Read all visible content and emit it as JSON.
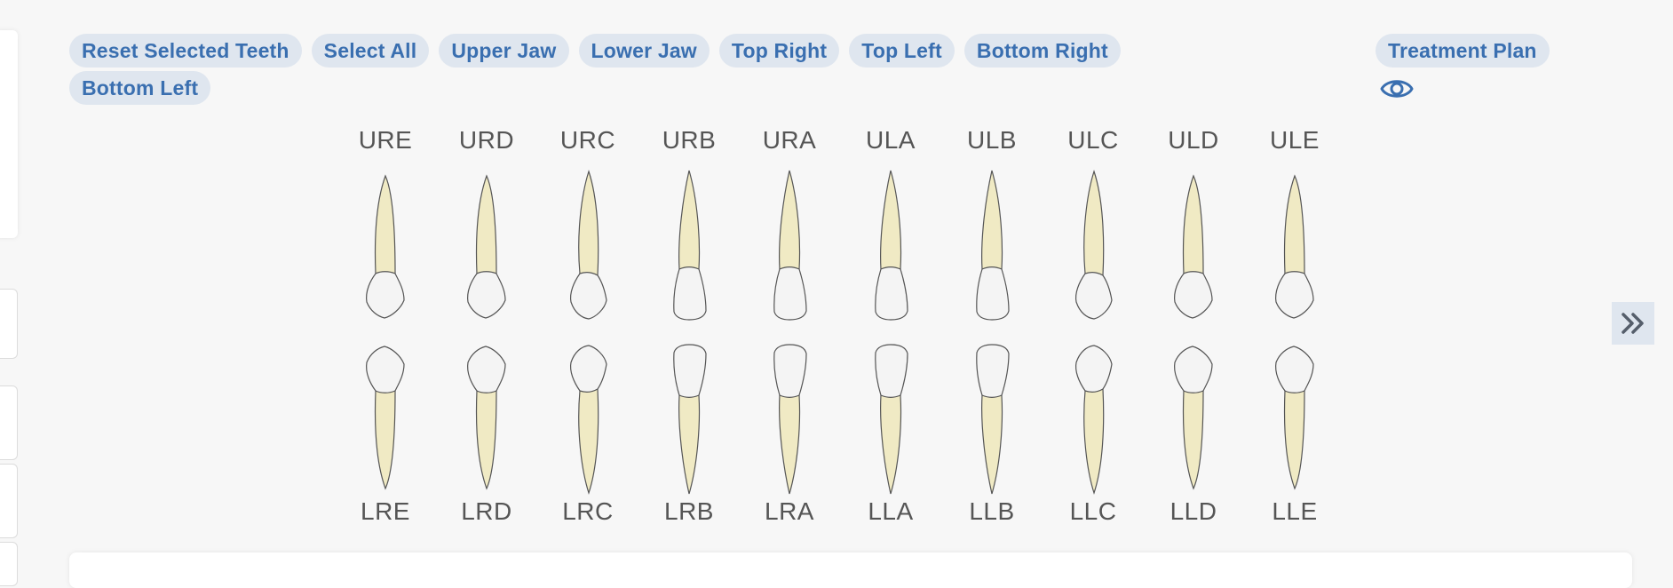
{
  "toolbar": {
    "reset_label": "Reset Selected Teeth",
    "select_all_label": "Select All",
    "upper_jaw_label": "Upper Jaw",
    "lower_jaw_label": "Lower Jaw",
    "top_right_label": "Top Right",
    "top_left_label": "Top Left",
    "bottom_right_label": "Bottom Right",
    "bottom_left_label": "Bottom Left"
  },
  "treatment_plan": {
    "label": "Treatment Plan",
    "icon": "eye-icon"
  },
  "expand_panel": {
    "icon": "double-chevron-right-icon"
  },
  "upper_teeth": [
    {
      "code": "URE",
      "shape": "molar"
    },
    {
      "code": "URD",
      "shape": "molar"
    },
    {
      "code": "URC",
      "shape": "canine"
    },
    {
      "code": "URB",
      "shape": "incisor"
    },
    {
      "code": "URA",
      "shape": "incisor"
    },
    {
      "code": "ULA",
      "shape": "incisor"
    },
    {
      "code": "ULB",
      "shape": "incisor"
    },
    {
      "code": "ULC",
      "shape": "canine"
    },
    {
      "code": "ULD",
      "shape": "molar"
    },
    {
      "code": "ULE",
      "shape": "molar"
    }
  ],
  "lower_teeth": [
    {
      "code": "LRE",
      "shape": "molar"
    },
    {
      "code": "LRD",
      "shape": "molar"
    },
    {
      "code": "LRC",
      "shape": "canine"
    },
    {
      "code": "LRB",
      "shape": "incisor"
    },
    {
      "code": "LRA",
      "shape": "incisor"
    },
    {
      "code": "LLA",
      "shape": "incisor"
    },
    {
      "code": "LLB",
      "shape": "incisor"
    },
    {
      "code": "LLC",
      "shape": "canine"
    },
    {
      "code": "LLD",
      "shape": "molar"
    },
    {
      "code": "LLE",
      "shape": "molar"
    }
  ],
  "colors": {
    "chip_background": "#dfe6ef",
    "chip_text": "#3a6fb0",
    "root_fill": "#f0eac4",
    "crown_fill": "#f4f4f4",
    "outline": "#555555",
    "label_text": "#555555"
  }
}
